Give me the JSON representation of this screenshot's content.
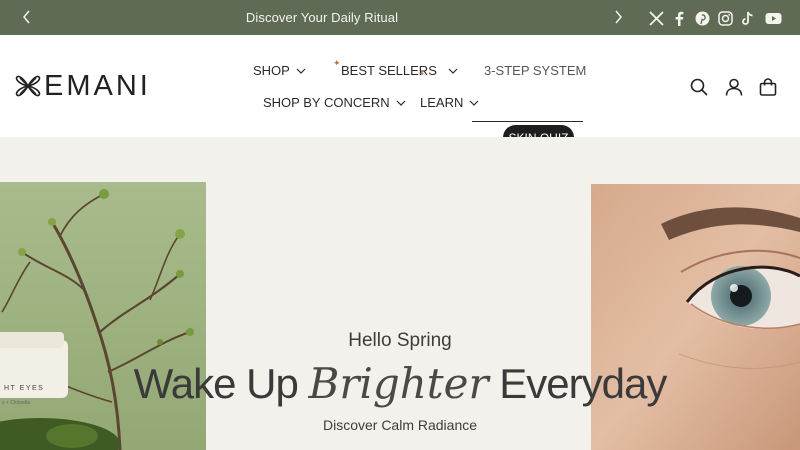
{
  "announcement": {
    "message": "Discover Your Daily Ritual",
    "social": [
      "x-icon",
      "facebook-icon",
      "pinterest-icon",
      "instagram-icon",
      "tiktok-icon",
      "youtube-icon"
    ]
  },
  "header": {
    "logo_text": "EMANI",
    "nav": {
      "shop": "SHOP",
      "best_sellers": "BEST SELLERS",
      "three_step": "3-STEP SYSTEM",
      "concern": "SHOP BY CONCERN",
      "learn": "LEARN",
      "quiz": "SKIN QUIZ"
    },
    "icons": [
      "search-icon",
      "account-icon",
      "bag-icon"
    ]
  },
  "hero": {
    "eyebrow": "Hello Spring",
    "headline_pre": "Wake Up",
    "headline_italic": "Brighter",
    "headline_post": "Everyday",
    "subtitle": "Discover Calm Radiance",
    "jar_label_line1": "HT EYES",
    "jar_label_line2": "s + Chlorella"
  },
  "colors": {
    "announce_bg": "#5f6b55",
    "hero_bg": "#f3f1ec",
    "quiz_bg": "#1e1e1e",
    "sparkle": "#c0703a"
  }
}
